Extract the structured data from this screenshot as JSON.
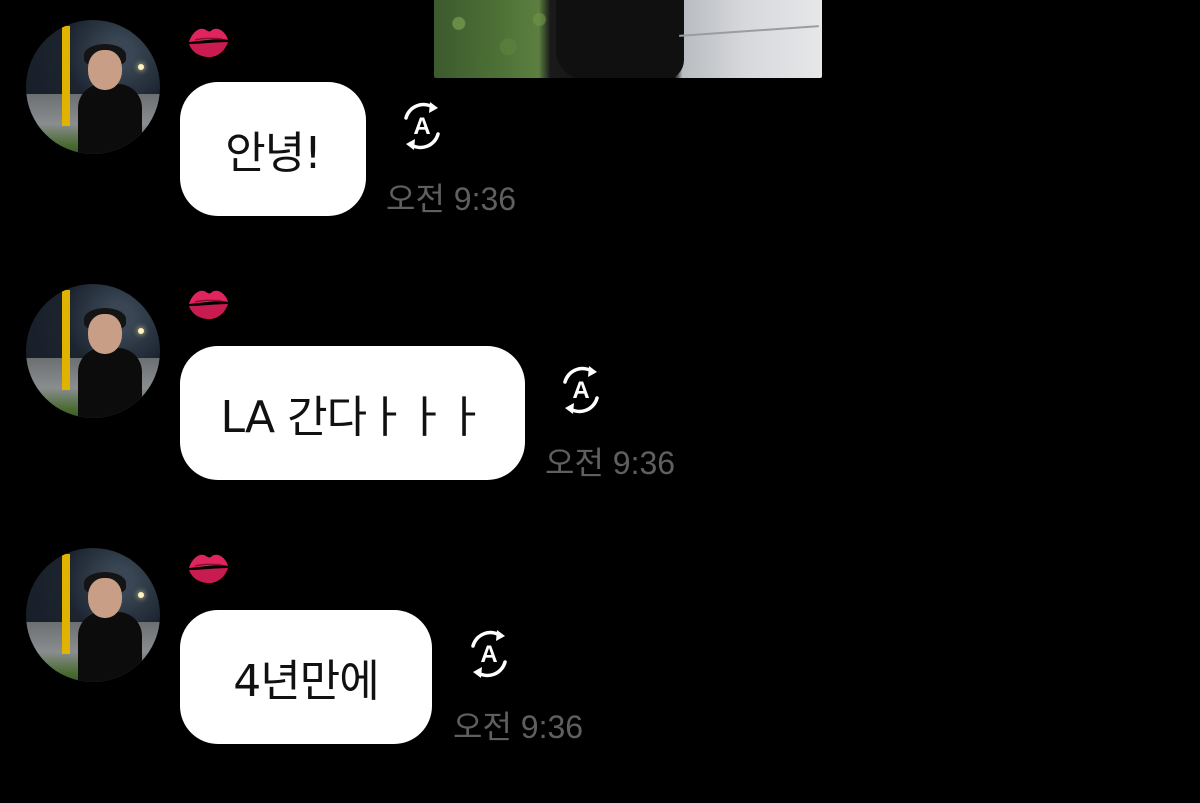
{
  "messages": [
    {
      "text": "안녕!",
      "time": "오전 9:36",
      "reaction_icon": "kiss-mark-emoji",
      "action_icon": "auto-translate-icon"
    },
    {
      "text": "LA 간다ㅏㅏㅏ",
      "time": "오전 9:36",
      "reaction_icon": "kiss-mark-emoji",
      "action_icon": "auto-translate-icon"
    },
    {
      "text": "4년만에",
      "time": "오전 9:36",
      "reaction_icon": "kiss-mark-emoji",
      "action_icon": "auto-translate-icon"
    }
  ],
  "colors": {
    "background": "#000000",
    "bubble": "#ffffff",
    "bubble_text": "#111111",
    "timestamp": "#5f5f5f",
    "lips": "#e0245e"
  }
}
